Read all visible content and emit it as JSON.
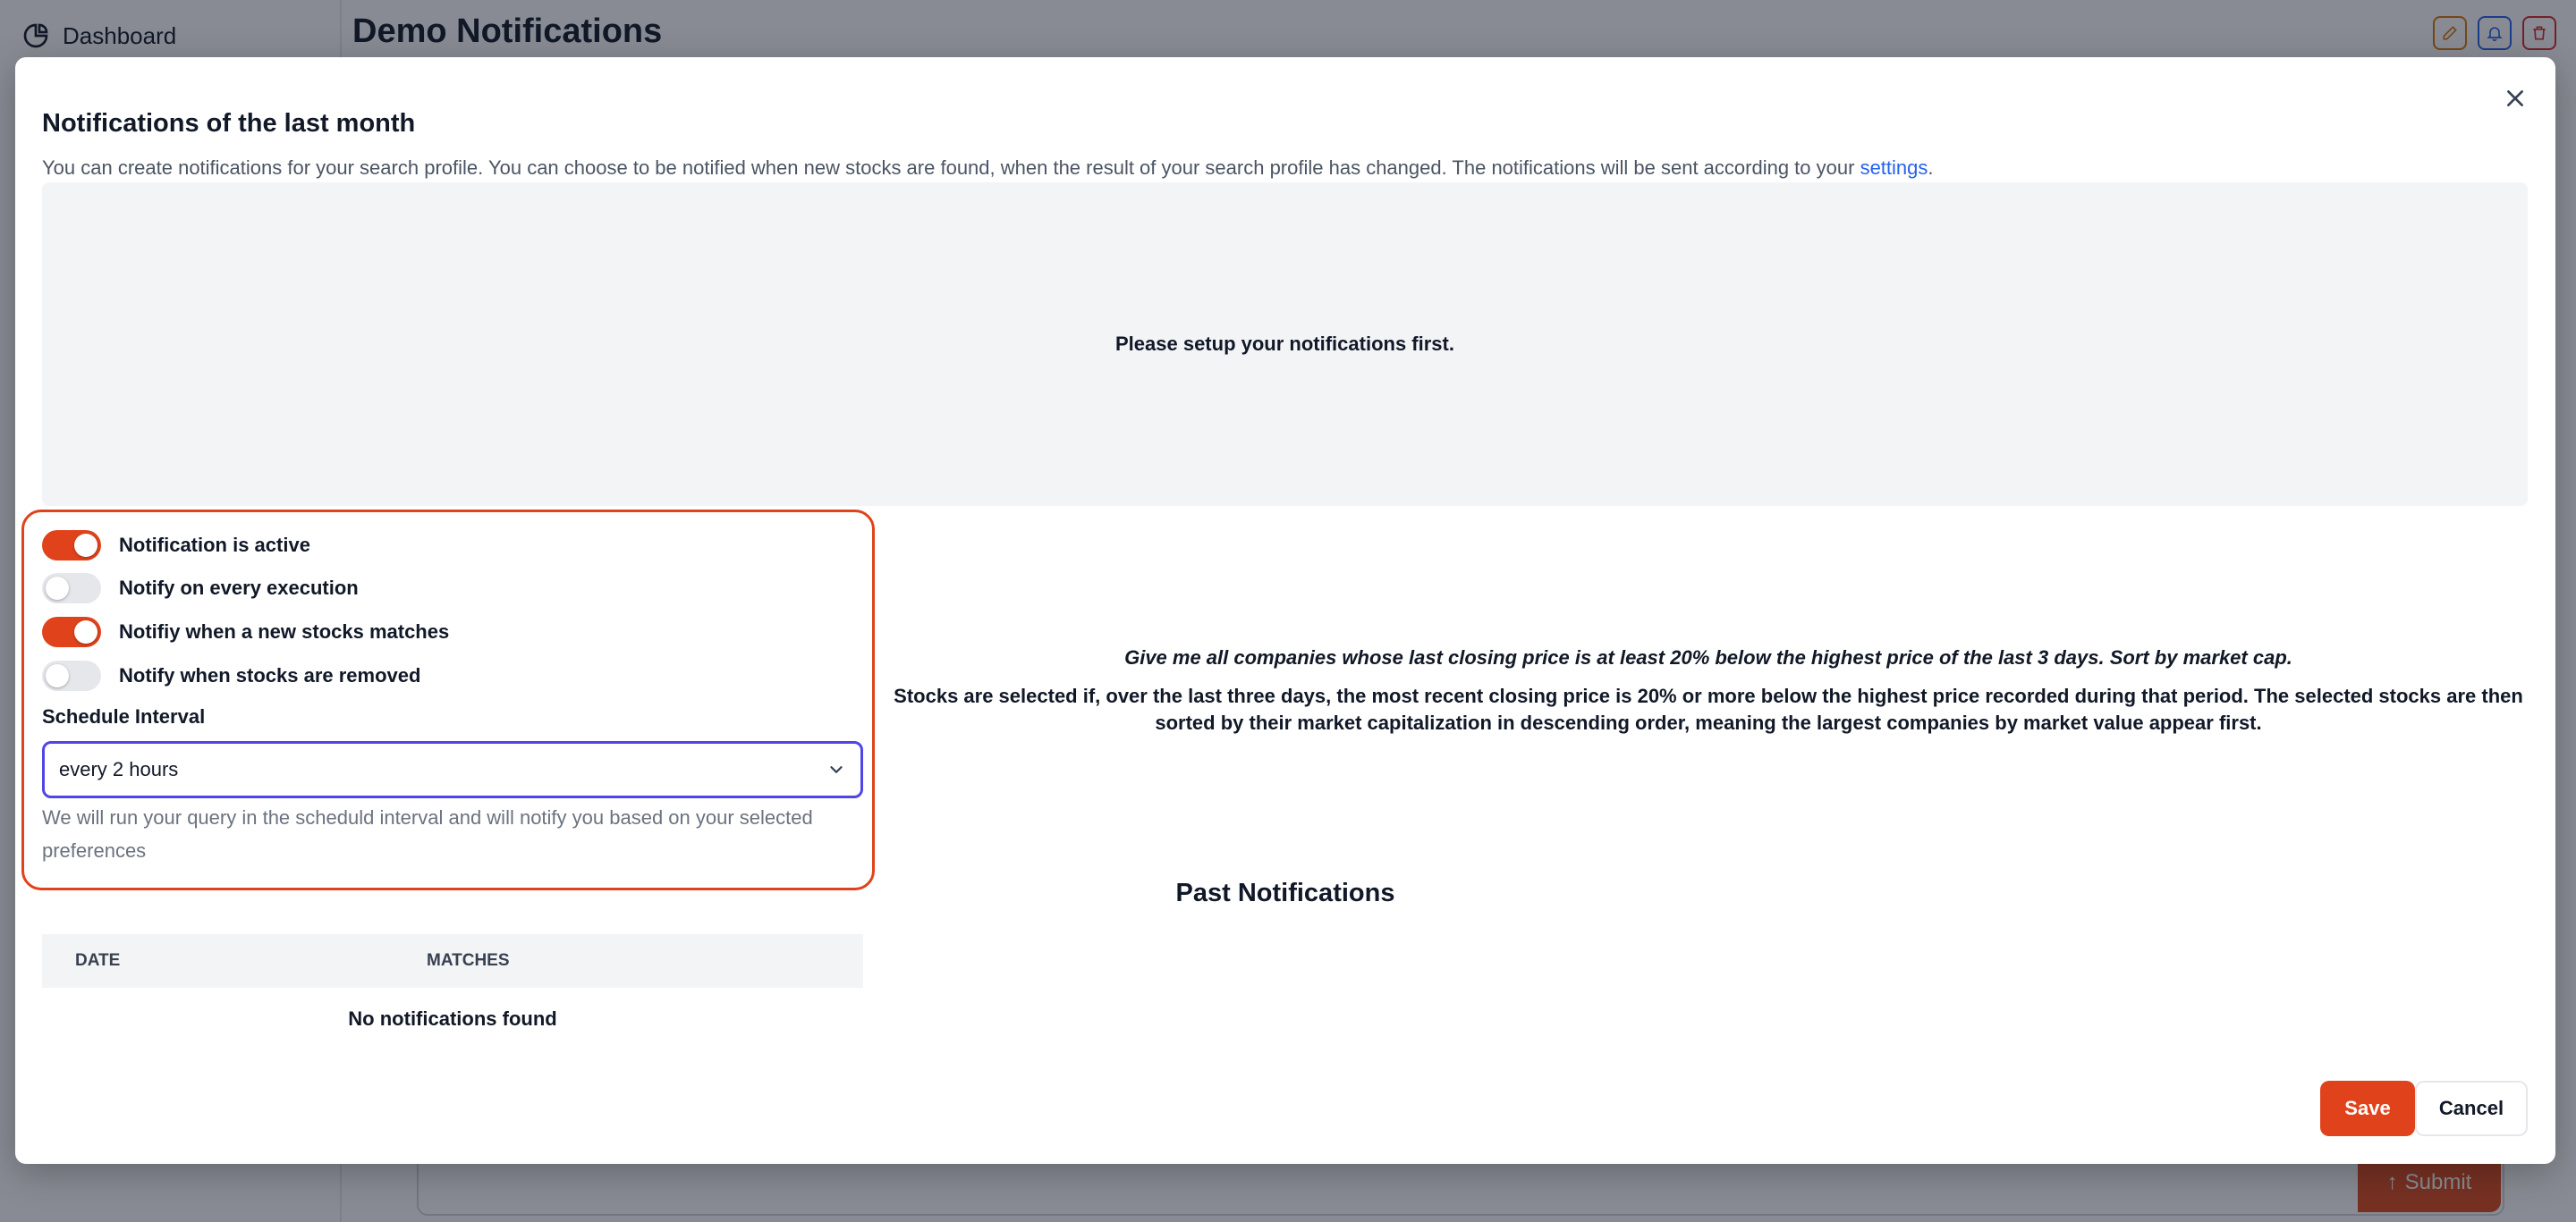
{
  "background": {
    "nav_dashboard": "Dashboard",
    "page_title": "Demo Notifications",
    "submit_label": "Submit"
  },
  "modal": {
    "title": "Notifications of the last month",
    "description": "You can create notifications for your search profile. You can choose to be notified when new stocks are found, when the result of your search profile has changed. The notifications will be sent according to your ",
    "settings_link": "settings",
    "description_end": ".",
    "placeholder": "Please setup your notifications first.",
    "toggles": [
      {
        "label": "Notification is active",
        "on": true
      },
      {
        "label": "Notify on every execution",
        "on": false
      },
      {
        "label": "Notifiy when a new stocks matches",
        "on": true
      },
      {
        "label": "Notify when stocks are removed",
        "on": false
      }
    ],
    "schedule_label": "Schedule Interval",
    "schedule_value": "every 2 hours",
    "schedule_help": "We will run your query in the scheduld interval and will notify you based on your selected preferences",
    "query_text": "Give me all companies whose last closing price is at least 20% below the highest price of the last 3 days. Sort by market cap.",
    "query_explanation": "Stocks are selected if, over the last three days, the most recent closing price is 20% or more below the highest price recorded during that period. The selected stocks are then sorted by their market capitalization in descending order, meaning the largest companies by market value appear first.",
    "past_title": "Past Notifications",
    "table": {
      "col_date": "DATE",
      "col_matches": "MATCHES",
      "empty": "No notifications found"
    },
    "save_label": "Save",
    "cancel_label": "Cancel"
  },
  "colors": {
    "accent": "#e0431b",
    "focus": "#4f46e5",
    "link": "#2563eb"
  }
}
